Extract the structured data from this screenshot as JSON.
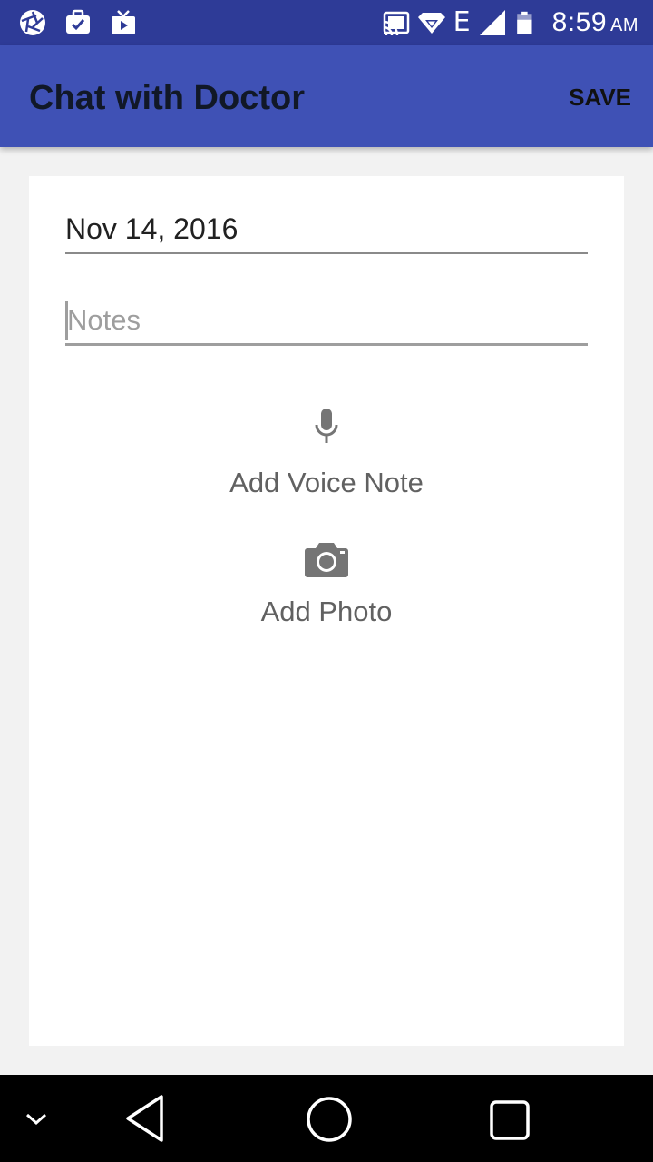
{
  "status_bar": {
    "icons_left": [
      "aperture-icon",
      "work-bag-icon",
      "video-cast-icon"
    ],
    "icons_right": [
      "cast-icon",
      "wifi-icon",
      "signal-icon",
      "battery-icon"
    ],
    "network_type": "E",
    "time": "8:59",
    "ampm": "AM"
  },
  "app_bar": {
    "title": "Chat with Doctor",
    "save_label": "SAVE",
    "background": "#3f51b5"
  },
  "form": {
    "date_value": "Nov 14, 2016",
    "notes_placeholder": "Notes",
    "notes_value": ""
  },
  "actions": {
    "voice_note_label": "Add Voice Note",
    "voice_note_icon": "microphone-icon",
    "photo_label": "Add Photo",
    "photo_icon": "camera-icon"
  },
  "nav_bar": {
    "buttons": [
      "chevron-down-icon",
      "back-icon",
      "home-icon",
      "recents-icon"
    ]
  }
}
